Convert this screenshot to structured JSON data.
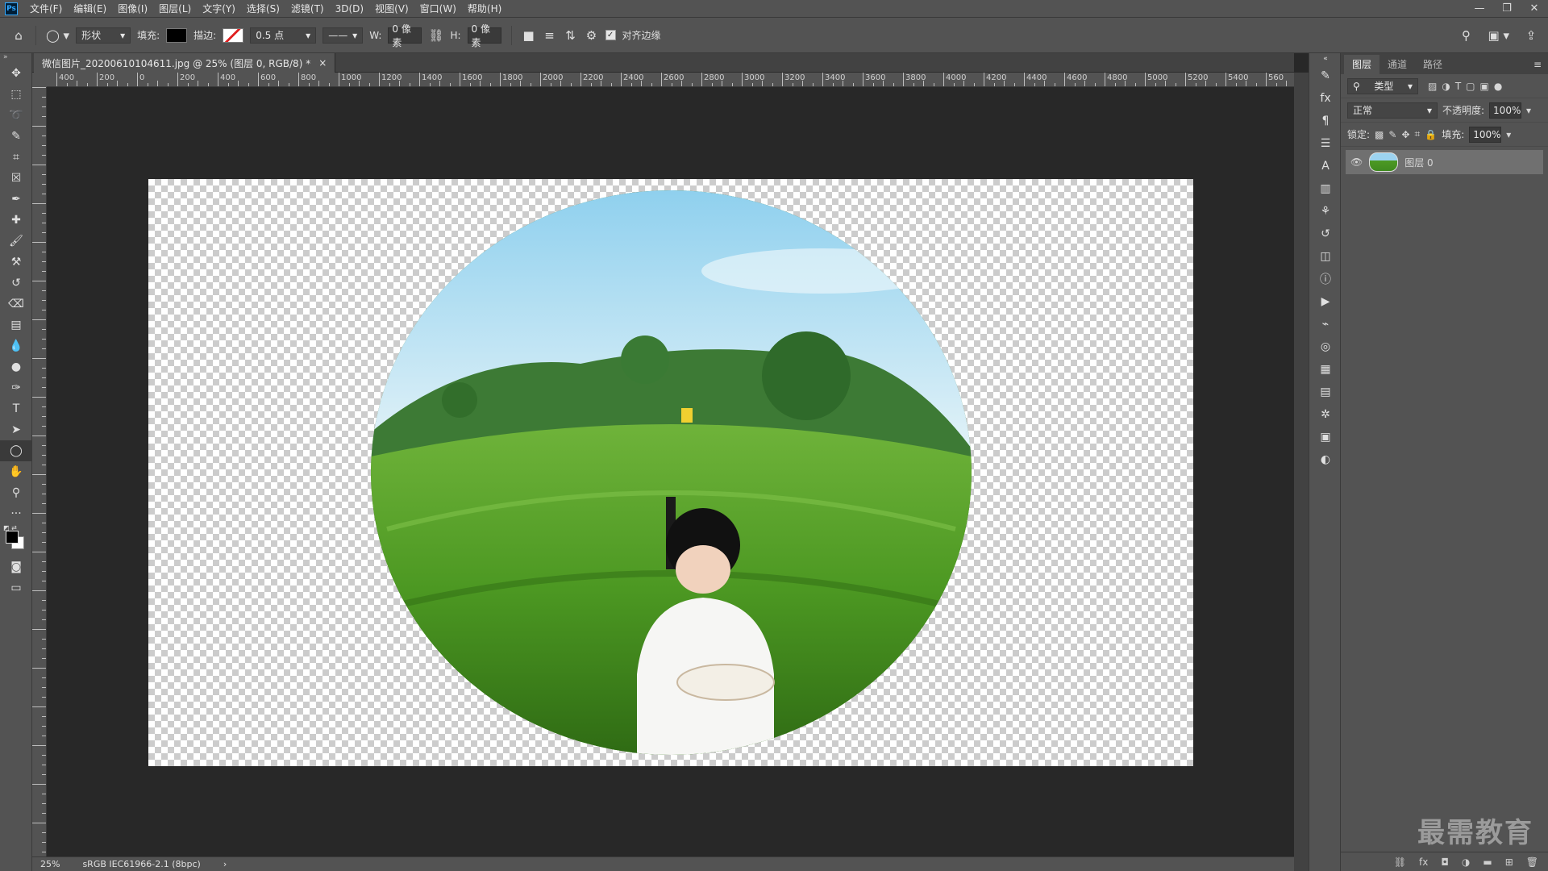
{
  "app": {
    "logo": "Ps"
  },
  "menu": [
    "文件(F)",
    "编辑(E)",
    "图像(I)",
    "图层(L)",
    "文字(Y)",
    "选择(S)",
    "滤镜(T)",
    "3D(D)",
    "视图(V)",
    "窗口(W)",
    "帮助(H)"
  ],
  "window_controls": {
    "minimize": "—",
    "restore": "❐",
    "close": "✕"
  },
  "options": {
    "mode": "形状",
    "fill_label": "填充:",
    "fill_color": "#000000",
    "stroke_label": "描边:",
    "stroke_width": "0.5 点",
    "w_label": "W:",
    "w_value": "0 像素",
    "h_label": "H:",
    "h_value": "0 像素",
    "align_edges_label": "对齐边缘",
    "align_edges_checked": true
  },
  "document": {
    "tab_title": "微信图片_20200610104611.jpg @ 25% (图层 0, RGB/8) *",
    "close": "×"
  },
  "ruler_h": [
    "400",
    "200",
    "0",
    "200",
    "400",
    "600",
    "800",
    "1000",
    "1200",
    "1400",
    "1600",
    "1800",
    "2000",
    "2200",
    "2400",
    "2600",
    "2800",
    "3000",
    "3200",
    "3400",
    "3600",
    "3800",
    "4000",
    "4200",
    "4400",
    "4600",
    "4800",
    "5000",
    "5200",
    "5400",
    "560"
  ],
  "status": {
    "zoom": "25%",
    "profile": "sRGB IEC61966-2.1 (8bpc)",
    "arrow": "›"
  },
  "layers_panel": {
    "tabs": [
      "图层",
      "通道",
      "路径"
    ],
    "filter_kind": "类型",
    "blend_mode": "正常",
    "opacity_label": "不透明度:",
    "opacity_value": "100%",
    "lock_label": "锁定:",
    "fill_label": "填充:",
    "fill_value": "100%",
    "layers": [
      {
        "name": "图层 0",
        "visible": true
      }
    ]
  },
  "watermark": "最需教育",
  "colors": {
    "foreground": "#000000",
    "background": "#ffffff"
  }
}
